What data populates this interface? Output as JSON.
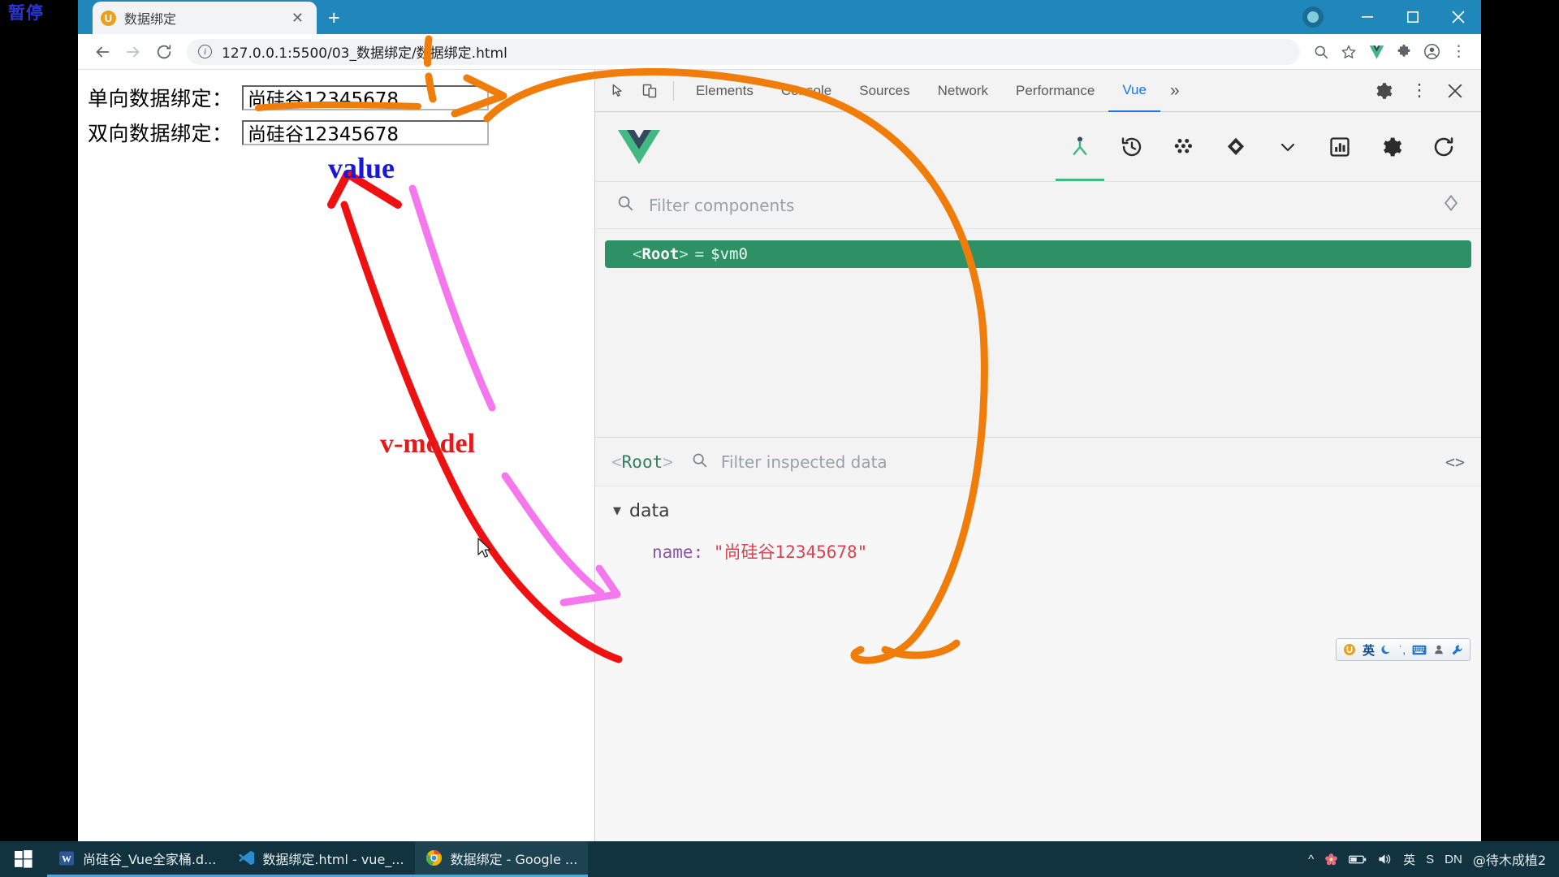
{
  "overlay": {
    "pause_label": "暂停"
  },
  "browser": {
    "tab": {
      "title": "数据绑定",
      "favicon": "vue-app-icon",
      "close_label": "✕"
    },
    "newtab_label": "+",
    "window_controls": {
      "minimize": "minimize-icon",
      "maximize": "maximize-icon",
      "close": "close-icon"
    },
    "toolbar": {
      "back": "back-arrow-icon",
      "forward": "forward-arrow-icon",
      "reload": "reload-icon",
      "url": "127.0.0.1:5500/03_数据绑定/数据绑定.html",
      "info_glyph": "i",
      "zoom_icon": "zoom-search-icon",
      "bookmark_icon": "star-icon",
      "ext_vue_icon": "vue-devtools-extension-icon",
      "ext_puzzle_icon": "extensions-puzzle-icon",
      "profile_icon": "profile-avatar-icon",
      "menu_icon": "three-dot-menu-icon"
    }
  },
  "page": {
    "rows": [
      {
        "label": "单向数据绑定：",
        "value": "尚硅谷12345678"
      },
      {
        "label": "双向数据绑定：",
        "value": "尚硅谷12345678"
      }
    ]
  },
  "devtools": {
    "tools": {
      "inspect": "inspect-element-icon",
      "device": "device-toolbar-icon"
    },
    "tabs": [
      {
        "label": "Elements",
        "active": false
      },
      {
        "label": "Console",
        "active": false
      },
      {
        "label": "Sources",
        "active": false
      },
      {
        "label": "Network",
        "active": false
      },
      {
        "label": "Performance",
        "active": false
      },
      {
        "label": "Vue",
        "active": true
      }
    ],
    "more_label": "»",
    "right_icons": {
      "settings": "gear-icon",
      "menu": "three-dot-menu-icon",
      "close": "close-icon"
    },
    "vue": {
      "logo": "vue-logo",
      "tools": [
        {
          "name": "components-tree-icon",
          "active": true
        },
        {
          "name": "timeline-history-icon",
          "active": false
        },
        {
          "name": "vuex-icon",
          "active": false
        },
        {
          "name": "routes-icon",
          "active": false
        },
        {
          "name": "chevron-down-icon",
          "active": false
        },
        {
          "name": "performance-bars-icon",
          "active": false
        },
        {
          "name": "settings-gear-icon",
          "active": false
        },
        {
          "name": "refresh-icon",
          "active": false
        }
      ],
      "filter_placeholder": "Filter components",
      "select_target_icon": "select-target-icon",
      "tree": [
        {
          "open_angle": "<",
          "name": "Root",
          "close_angle": ">",
          "equals": "=",
          "instance": "$vm0"
        }
      ],
      "inspector": {
        "root_open": "<",
        "root_name": "Root",
        "root_close": ">",
        "filter_placeholder": "Filter inspected data",
        "code_icon": "<>",
        "groups": [
          {
            "caret": "▼",
            "title": "data",
            "props": [
              {
                "key": "name",
                "colon": ":",
                "value": "\"尚硅谷12345678\""
              }
            ]
          }
        ]
      }
    }
  },
  "annotations": {
    "value_label": "value",
    "vmodel_label": "v-model",
    "colors": {
      "value": "#1a18d6",
      "vmodel": "#e01b1b",
      "red_arrow": "#ee1111",
      "pink_arrow": "#f477ee",
      "orange_arrow": "#f07d0a"
    }
  },
  "ime": {
    "items": [
      "ime-logo-icon",
      "英",
      "moon-icon",
      "punctuation-icon",
      "keyboard-icon",
      "user-icon",
      "wrench-icon"
    ]
  },
  "taskbar": {
    "start": "windows-start-icon",
    "tasks": [
      {
        "icon": "word-icon",
        "label": "尚硅谷_Vue全家桶.d...",
        "active": false,
        "underline": true
      },
      {
        "icon": "vscode-icon",
        "label": "数据绑定.html - vue_...",
        "active": false,
        "underline": true
      },
      {
        "icon": "chrome-icon",
        "label": "数据绑定 - Google ...",
        "active": true,
        "underline": true
      }
    ],
    "tray": {
      "chevron": "^",
      "flower_icon": "flower-tray-icon",
      "battery_icon": "battery-icon",
      "volume_icon": "volume-icon",
      "ime_mode": "英",
      "ime_s": "S",
      "ime_dn": "DN",
      "user": "@待木成植2"
    }
  }
}
